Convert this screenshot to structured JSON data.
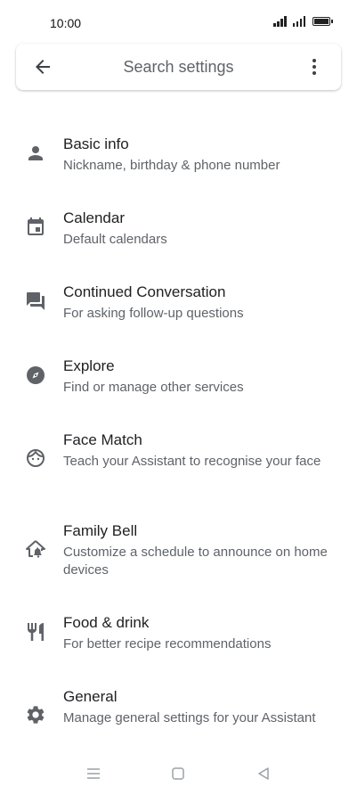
{
  "status": {
    "time": "10:00"
  },
  "search": {
    "placeholder": "Search settings"
  },
  "items": [
    {
      "icon": "person-icon",
      "title": "Basic info",
      "subtitle": "Nickname, birthday & phone number"
    },
    {
      "icon": "calendar-icon",
      "title": "Calendar",
      "subtitle": "Default calendars"
    },
    {
      "icon": "chat-icon",
      "title": "Continued Conversation",
      "subtitle": "For asking follow-up questions"
    },
    {
      "icon": "compass-icon",
      "title": "Explore",
      "subtitle": "Find or manage other services"
    },
    {
      "icon": "face-icon",
      "title": "Face Match",
      "subtitle": "Teach your Assistant to recognise your face"
    },
    {
      "icon": "home-bell-icon",
      "title": "Family Bell",
      "subtitle": "Customize a schedule to announce on home devices"
    },
    {
      "icon": "fork-knife-icon",
      "title": "Food & drink",
      "subtitle": "For better recipe recommendations"
    },
    {
      "icon": "gear-icon",
      "title": "General",
      "subtitle": "Manage general settings for your Assistant"
    }
  ]
}
